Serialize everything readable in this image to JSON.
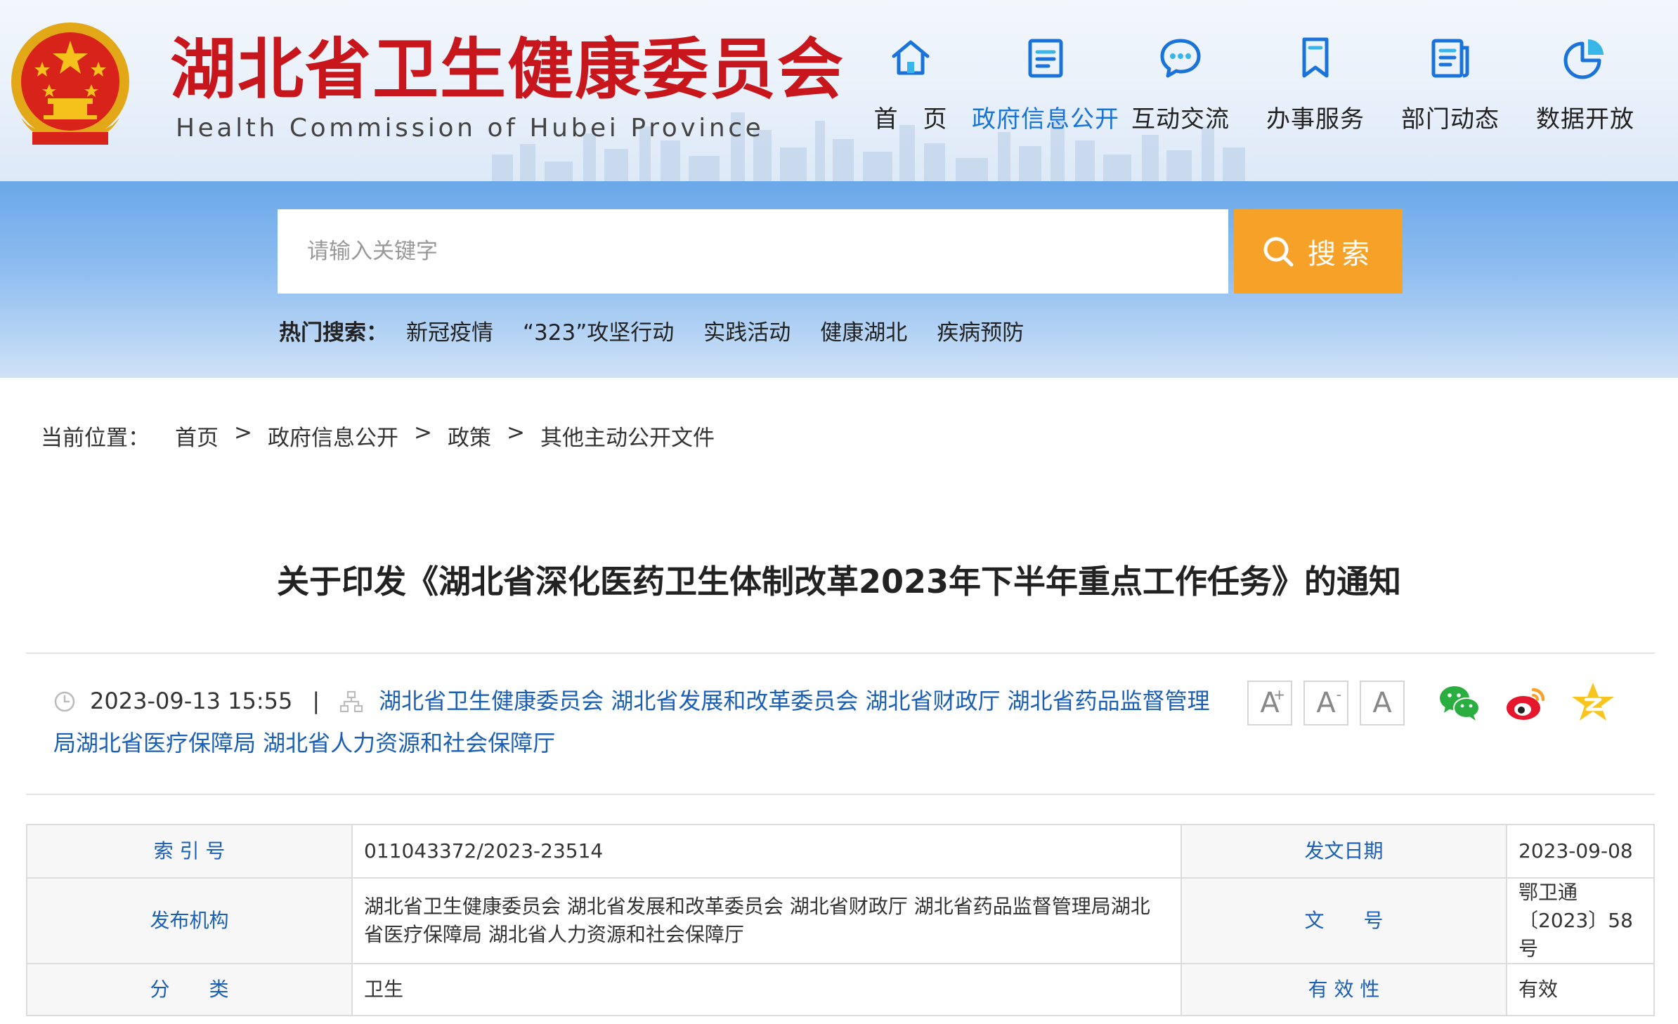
{
  "site": {
    "title": "湖北省卫生健康委员会",
    "subtitle": "Health Commission of Hubei Province"
  },
  "nav": [
    {
      "label": "首　页",
      "icon": "home-icon",
      "active": false
    },
    {
      "label": "政府信息公开",
      "icon": "document-icon",
      "active": true
    },
    {
      "label": "互动交流",
      "icon": "chat-icon",
      "active": false
    },
    {
      "label": "办事服务",
      "icon": "bookmark-icon",
      "active": false
    },
    {
      "label": "部门动态",
      "icon": "news-icon",
      "active": false
    },
    {
      "label": "数据开放",
      "icon": "pie-chart-icon",
      "active": false
    }
  ],
  "search": {
    "placeholder": "请输入关键字",
    "value": "",
    "button_label": "搜索",
    "hot_label": "热门搜索：",
    "hot_links": [
      "新冠疫情",
      "“323”攻坚行动",
      "实践活动",
      "健康湖北",
      "疾病预防"
    ]
  },
  "breadcrumb": {
    "prefix": "当前位置：",
    "items": [
      "首页",
      "政府信息公开",
      "政策",
      "其他主动公开文件"
    ],
    "separator": ">"
  },
  "article": {
    "title": "关于印发《湖北省深化医药卫生体制改革2023年下半年重点工作任务》的通知",
    "datetime": "2023-09-13 15:55",
    "pipe": "|",
    "sources": "湖北省卫生健康委员会 湖北省发展和改革委员会 湖北省财政厅 湖北省药品监督管理局湖北省医疗保障局 湖北省人力资源和社会保障厅"
  },
  "font_tools": {
    "large": "A",
    "large_mark": "+",
    "medium": "A",
    "medium_mark": "-",
    "small": "A"
  },
  "share": [
    "wechat-icon",
    "weibo-icon",
    "qzone-icon"
  ],
  "info_table": {
    "index_label": "索 引 号",
    "index_value": "011043372/2023-23514",
    "date_label": "发文日期",
    "date_value": "2023-09-08",
    "org_label": "发布机构",
    "org_value": "湖北省卫生健康委员会 湖北省发展和改革委员会 湖北省财政厅 湖北省药品监督管理局湖北省医疗保障局 湖北省人力资源和社会保障厅",
    "doc_no_label": "文　　号",
    "doc_no_value": "鄂卫通〔2023〕58号",
    "category_label": "分　　类",
    "category_value": "卫生",
    "validity_label": "有 效 性",
    "validity_value": "有效"
  },
  "colors": {
    "brand_red": "#c8161d",
    "link_blue": "#1a5fb4",
    "nav_active": "#1a73d9",
    "search_orange": "#f6a128"
  }
}
